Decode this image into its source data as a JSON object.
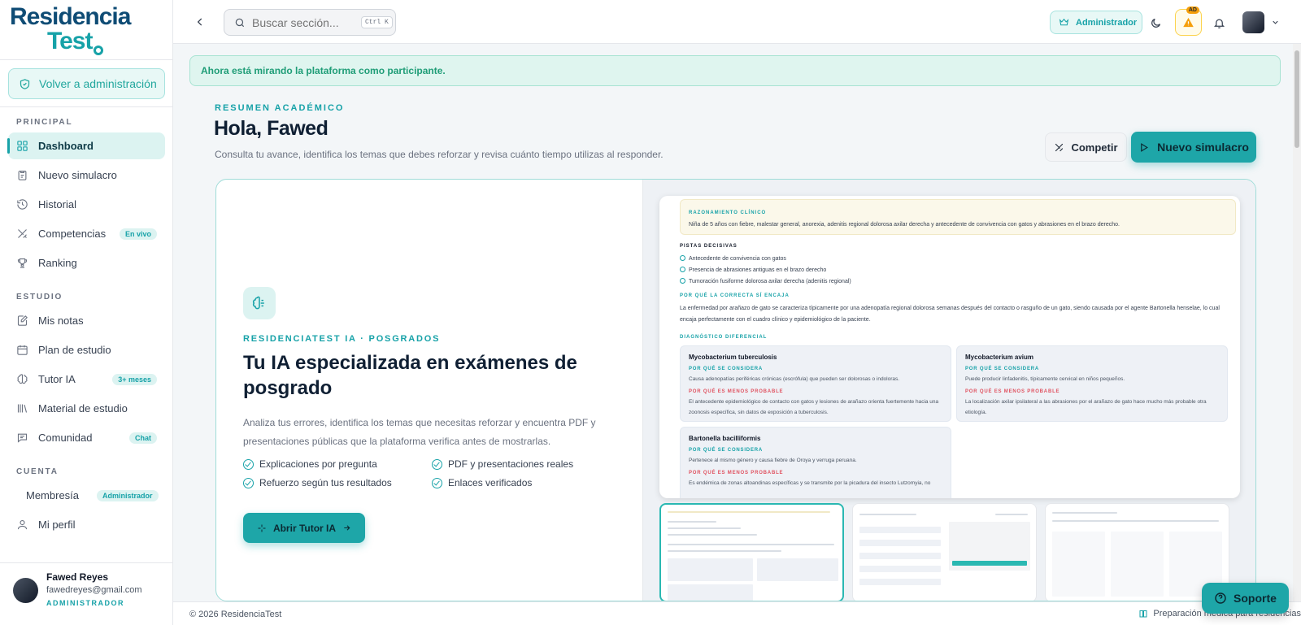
{
  "brand": {
    "line1": "Residencia",
    "line2": "Test"
  },
  "sidebar": {
    "back_admin": "Volver a administración",
    "sections": [
      {
        "title": "PRINCIPAL"
      },
      {
        "title": "ESTUDIO"
      },
      {
        "title": "CUENTA"
      }
    ],
    "items": [
      {
        "label": "Dashboard",
        "icon": "dashboard-grid-icon",
        "active": true
      },
      {
        "label": "Nuevo simulacro",
        "icon": "clipboard-icon"
      },
      {
        "label": "Historial",
        "icon": "history-icon"
      },
      {
        "label": "Competencias",
        "icon": "swords-icon",
        "badge": "En vivo"
      },
      {
        "label": "Ranking",
        "icon": "trophy-icon"
      },
      {
        "label": "Mis notas",
        "icon": "notes-icon"
      },
      {
        "label": "Plan de estudio",
        "icon": "calendar-icon"
      },
      {
        "label": "Tutor IA",
        "icon": "brain-icon",
        "badge": "3+ meses"
      },
      {
        "label": "Material de estudio",
        "icon": "library-icon"
      },
      {
        "label": "Comunidad",
        "icon": "chat-icon",
        "badge": "Chat"
      },
      {
        "label": "Membresía",
        "icon": "crown-icon",
        "badge": "Administrador"
      },
      {
        "label": "Mi perfil",
        "icon": "user-icon"
      }
    ],
    "profile": {
      "name": "Fawed Reyes",
      "email": "fawedreyes@gmail.com",
      "role": "ADMINISTRADOR"
    }
  },
  "header": {
    "search_placeholder": "Buscar sección...",
    "search_shortcut": "Ctrl K",
    "admin_badge": "Administrador",
    "warning_badge": "AD"
  },
  "notice": "Ahora está mirando la plataforma como participante.",
  "main": {
    "eyebrow": "RESUMEN ACADÉMICO",
    "greeting": "Hola, Fawed",
    "subtitle": "Consulta tu avance, identifica los temas que debes reforzar y revisa cuánto tiempo utilizas al responder.",
    "compete_button": "Competir",
    "new_button": "Nuevo simulacro"
  },
  "hero": {
    "eyebrow": "RESIDENCIATEST IA · POSGRADOS",
    "title": "Tu IA especializada en exámenes de posgrado",
    "description": "Analiza tus errores, identifica los temas que necesitas reforzar y encuentra PDF y presentaciones públicas que la plataforma verifica antes de mostrarlas.",
    "features": [
      "Explicaciones por pregunta",
      "PDF y presentaciones reales",
      "Refuerzo según tus resultados",
      "Enlaces verificados"
    ],
    "cta": "Abrir Tutor IA"
  },
  "preview": {
    "clinical_heading": "RAZONAMIENTO CLÍNICO",
    "clinical_text": "Niña de 5 años con fiebre, malestar general, anorexia, adenitis regional dolorosa axilar derecha y antecedente de convivencia con gatos y abrasiones en el brazo derecho.",
    "clues_heading": "PISTAS DECISIVAS",
    "clues": [
      "Antecedente de convivencia con gatos",
      "Presencia de abrasiones antiguas en el brazo derecho",
      "Tumoración fusiforme dolorosa axilar derecha (adenitis regional)"
    ],
    "correct_heading": "POR QUÉ LA CORRECTA SÍ ENCAJA",
    "correct_text_1": "La enfermedad por arañazo de gato se caracteriza típicamente por una adenopatía regional dolorosa semanas después del contacto o rasguño de un gato, siendo causada por el agente Bartonella henselae, lo cual",
    "correct_text_2": "encaja perfectamente con el cuadro clínico y epidemiológico de la paciente.",
    "diff_heading": "DIAGNÓSTICO DIFERENCIAL",
    "why_label": "POR QUÉ SE CONSIDERA",
    "less_label": "POR QUÉ ES MENOS PROBABLE",
    "cards": [
      {
        "name": "Mycobacterium tuberculosis",
        "why": "Causa adenopatías periféricas crónicas (escrófula) que pueden ser dolorosas o indoloras.",
        "less": "El antecedente epidemiológico de contacto con gatos y lesiones de arañazo orienta fuertemente hacia una zoonosis específica, sin datos de exposición a tuberculosis."
      },
      {
        "name": "Mycobacterium avium",
        "why": "Puede producir linfadenitis, típicamente cervical en niños pequeños.",
        "less": "La localización axilar ipsilateral a las abrasiones por el arañazo de gato hace mucho más probable otra etiología."
      },
      {
        "name": "Bartonella bacilliformis",
        "why": "Pertenece al mismo género y causa fiebre de Oroya y verruga peruana.",
        "less": "Es endémica de zonas altoandinas específicas y se transmite por la picadura del insecto Lutzomyia, no"
      }
    ]
  },
  "footer": {
    "copyright": "© 2026 ResidenciaTest",
    "tagline": "Preparación médica para residencias"
  },
  "support_button": "Soporte",
  "colors": {
    "accent": "#1ea6a8",
    "brand_dark": "#0f4c75",
    "notice_text": "#1f9d77",
    "warning": "#f59e0b"
  }
}
